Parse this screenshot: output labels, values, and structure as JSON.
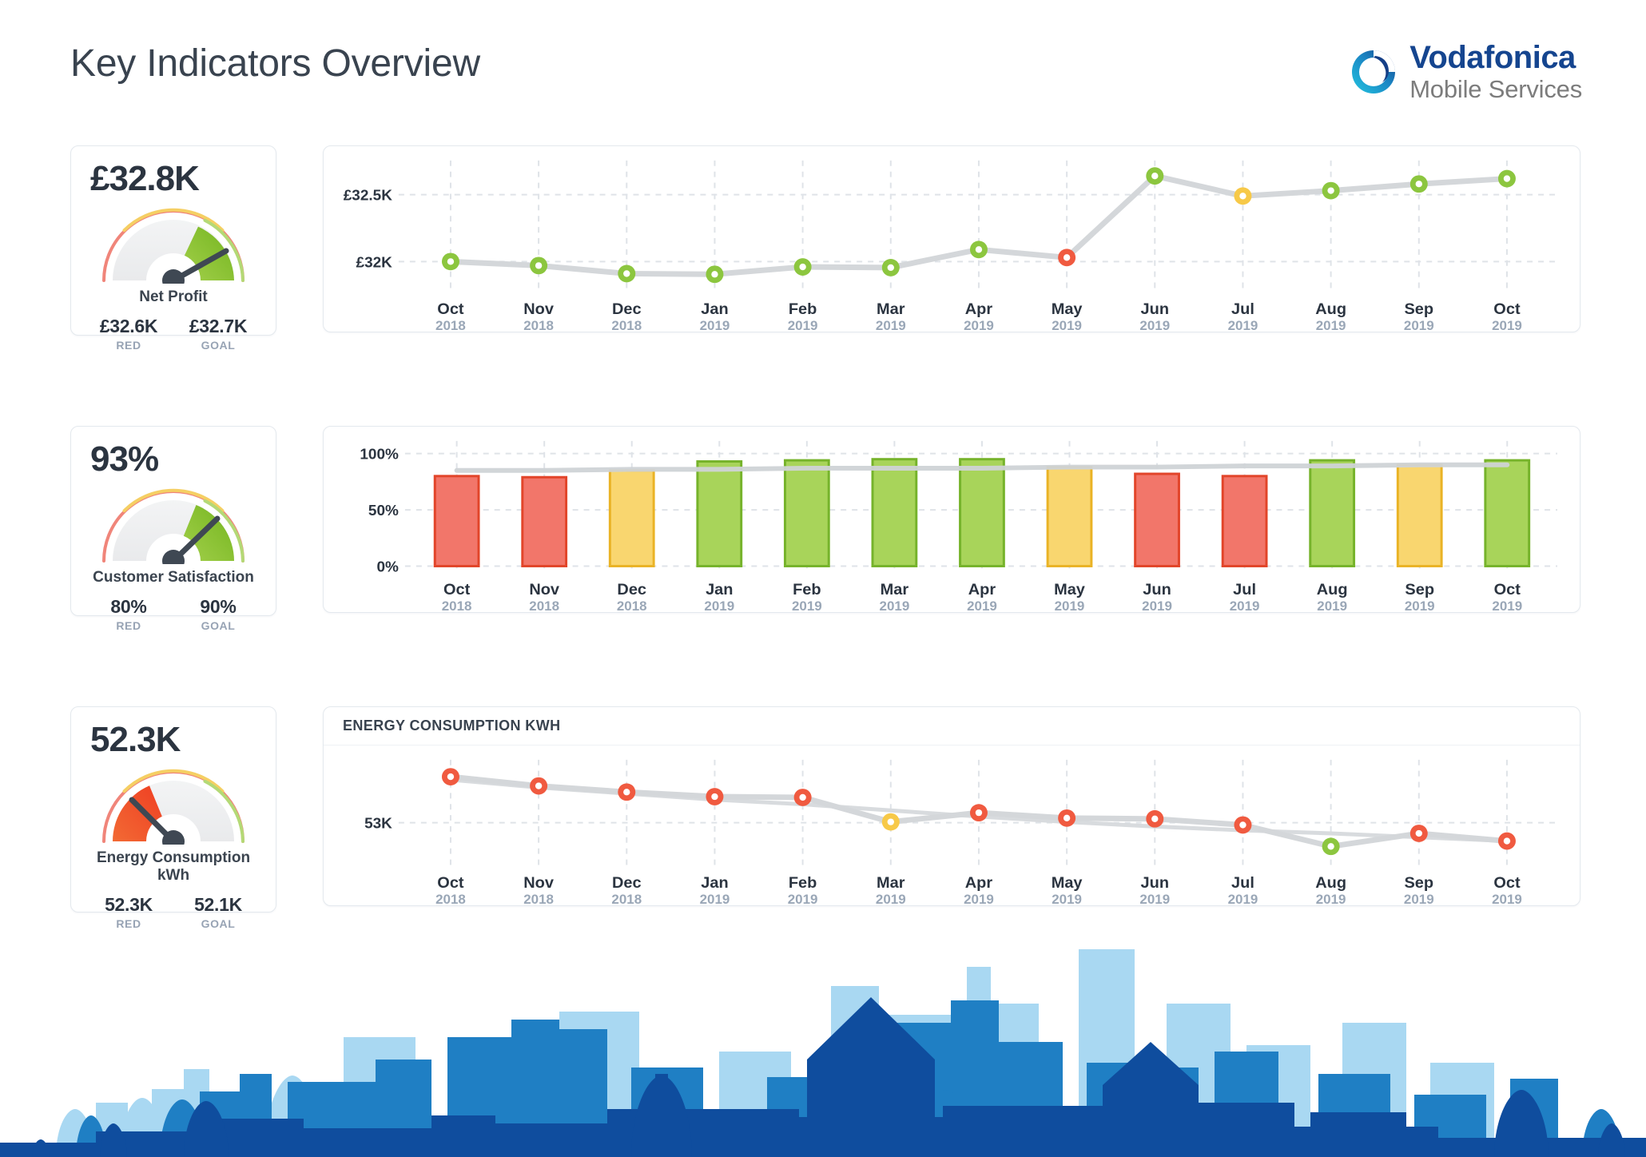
{
  "header": {
    "title": "Key Indicators Overview",
    "logo": {
      "name": "Vodafonica",
      "tagline": "Mobile Services",
      "icon": "swirl-circle-icon",
      "brand_color": "#15458f",
      "accent_color": "#2eb4d9"
    }
  },
  "palette": {
    "green": "#8CC63F",
    "green_dark": "#76b32b",
    "green_fill": "#a8d45a",
    "yellow": "#F7C948",
    "yellow_dark": "#eab326",
    "yellow_fill": "#f9d66f",
    "red": "#F05A40",
    "red_dark": "#e2452a",
    "red_fill": "#f2766a",
    "gray_line": "#d4d7da",
    "grid": "#dfe3e8",
    "text_dark": "#2b3440",
    "text_muted": "#97a3b4"
  },
  "kpis": [
    {
      "value": "£32.8K",
      "label": "Net Profit",
      "red_value": "£32.6K",
      "red_caption": "RED",
      "goal_value": "£32.7K",
      "goal_caption": "GOAL",
      "needle_angle_deg": 58,
      "band_start_deg": 25,
      "band_color": "green"
    },
    {
      "value": "93%",
      "label": "Customer Satisfaction",
      "red_value": "80%",
      "red_caption": "RED",
      "goal_value": "90%",
      "goal_caption": "GOAL",
      "needle_angle_deg": 44,
      "band_start_deg": 22,
      "band_color": "green"
    },
    {
      "value": "52.3K",
      "label": "Energy Consumption kWh",
      "red_value": "52.3K",
      "red_caption": "RED",
      "goal_value": "52.1K",
      "goal_caption": "GOAL",
      "needle_angle_deg": 133,
      "band_start_deg": 0,
      "band_color": "red"
    }
  ],
  "chart_data": [
    {
      "type": "line",
      "title": "",
      "categories": [
        "Oct",
        "Nov",
        "Dec",
        "Jan",
        "Feb",
        "Mar",
        "Apr",
        "May",
        "Jun",
        "Jul",
        "Aug",
        "Sep",
        "Oct"
      ],
      "category_years": [
        "2018",
        "2018",
        "2018",
        "2019",
        "2019",
        "2019",
        "2019",
        "2019",
        "2019",
        "2019",
        "2019",
        "2019",
        "2019"
      ],
      "values": [
        32000,
        31970,
        31910,
        31905,
        31960,
        31955,
        32090,
        32030,
        32640,
        32490,
        32530,
        32580,
        32620
      ],
      "point_status": [
        "green",
        "green",
        "green",
        "green",
        "green",
        "green",
        "green",
        "red",
        "green",
        "yellow",
        "green",
        "green",
        "green"
      ],
      "ytick_labels": [
        "£32.5K",
        "£32K"
      ],
      "ytick_values": [
        32500,
        32000
      ],
      "ylim": [
        31820,
        32720
      ],
      "xlabel": "",
      "ylabel": "",
      "grid": true,
      "legend": "none"
    },
    {
      "type": "bar",
      "title": "",
      "categories": [
        "Oct",
        "Nov",
        "Dec",
        "Jan",
        "Feb",
        "Mar",
        "Apr",
        "May",
        "Jun",
        "Jul",
        "Aug",
        "Sep",
        "Oct"
      ],
      "category_years": [
        "2018",
        "2018",
        "2018",
        "2019",
        "2019",
        "2019",
        "2019",
        "2019",
        "2019",
        "2019",
        "2019",
        "2019",
        "2019"
      ],
      "values": [
        80,
        79,
        85,
        93,
        94,
        95,
        95,
        88,
        82,
        80,
        94,
        90,
        94
      ],
      "bar_status": [
        "red",
        "red",
        "yellow",
        "green",
        "green",
        "green",
        "green",
        "yellow",
        "red",
        "red",
        "green",
        "yellow",
        "green"
      ],
      "target_line": [
        85,
        85,
        86,
        86,
        87,
        87,
        87,
        88,
        88,
        89,
        89,
        90,
        90
      ],
      "ytick_labels": [
        "100%",
        "50%",
        "0%"
      ],
      "ytick_values": [
        100,
        50,
        0
      ],
      "ylim": [
        0,
        107
      ],
      "xlabel": "",
      "ylabel": "",
      "grid": true,
      "legend": "none"
    },
    {
      "type": "line",
      "title": "ENERGY CONSUMPTION KWH",
      "categories": [
        "Oct",
        "Nov",
        "Dec",
        "Jan",
        "Feb",
        "Mar",
        "Apr",
        "May",
        "Jun",
        "Jul",
        "Aug",
        "Sep",
        "Oct"
      ],
      "category_years": [
        "2018",
        "2018",
        "2018",
        "2019",
        "2019",
        "2019",
        "2019",
        "2019",
        "2019",
        "2019",
        "2019",
        "2019",
        "2019"
      ],
      "values": [
        53600,
        53480,
        53400,
        53340,
        53330,
        53010,
        53130,
        53060,
        53050,
        52970,
        52690,
        52860,
        52760
      ],
      "point_status": [
        "red",
        "red",
        "red",
        "red",
        "red",
        "yellow",
        "red",
        "red",
        "red",
        "red",
        "green",
        "red",
        "red"
      ],
      "target_line": [
        53560,
        53460,
        53380,
        53300,
        53240,
        53160,
        53080,
        53010,
        52950,
        52900,
        52860,
        52810,
        52760
      ],
      "ytick_labels": [
        "53K"
      ],
      "ytick_values": [
        53000
      ],
      "ylim": [
        52520,
        53760
      ],
      "xlabel": "",
      "ylabel": "",
      "grid": true,
      "legend": "none"
    }
  ],
  "footer": {
    "graphic": "city-skyline-silhouette"
  }
}
